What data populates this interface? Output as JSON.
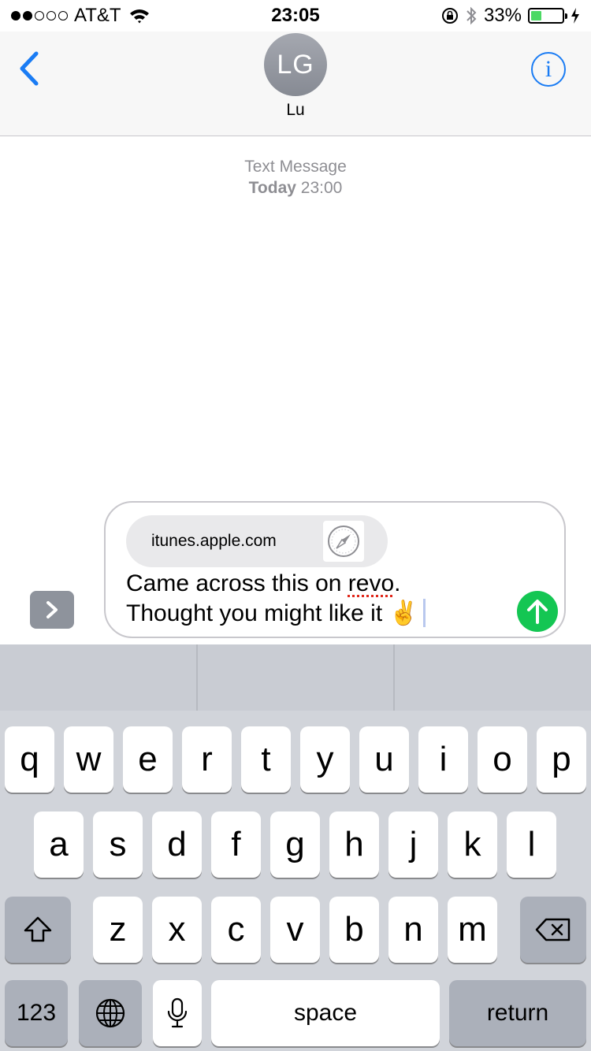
{
  "status_bar": {
    "carrier": "AT&T",
    "time": "23:05",
    "battery_percent": "33%",
    "battery_level": 0.33,
    "signal_bars_filled": 2,
    "signal_bars_total": 5
  },
  "header": {
    "avatar_initials": "LG",
    "contact_name": "Lu",
    "info_label": "i"
  },
  "conversation": {
    "service_label": "Text Message",
    "day_label": "Today",
    "time_label": "23:00"
  },
  "compose": {
    "link_domain": "itunes.apple.com",
    "line1_before": "Came across this on ",
    "misspelled_word": "revo",
    "line1_after": ".",
    "line2": "Thought you might like it ✌️"
  },
  "keyboard": {
    "row1": [
      "q",
      "w",
      "e",
      "r",
      "t",
      "y",
      "u",
      "i",
      "o",
      "p"
    ],
    "row2": [
      "a",
      "s",
      "d",
      "f",
      "g",
      "h",
      "j",
      "k",
      "l"
    ],
    "row3": [
      "z",
      "x",
      "c",
      "v",
      "b",
      "n",
      "m"
    ],
    "numbers_label": "123",
    "space_label": "space",
    "return_label": "return"
  },
  "colors": {
    "accent": "#1a7cf4",
    "send": "#14c653",
    "battery": "#4cd964"
  }
}
